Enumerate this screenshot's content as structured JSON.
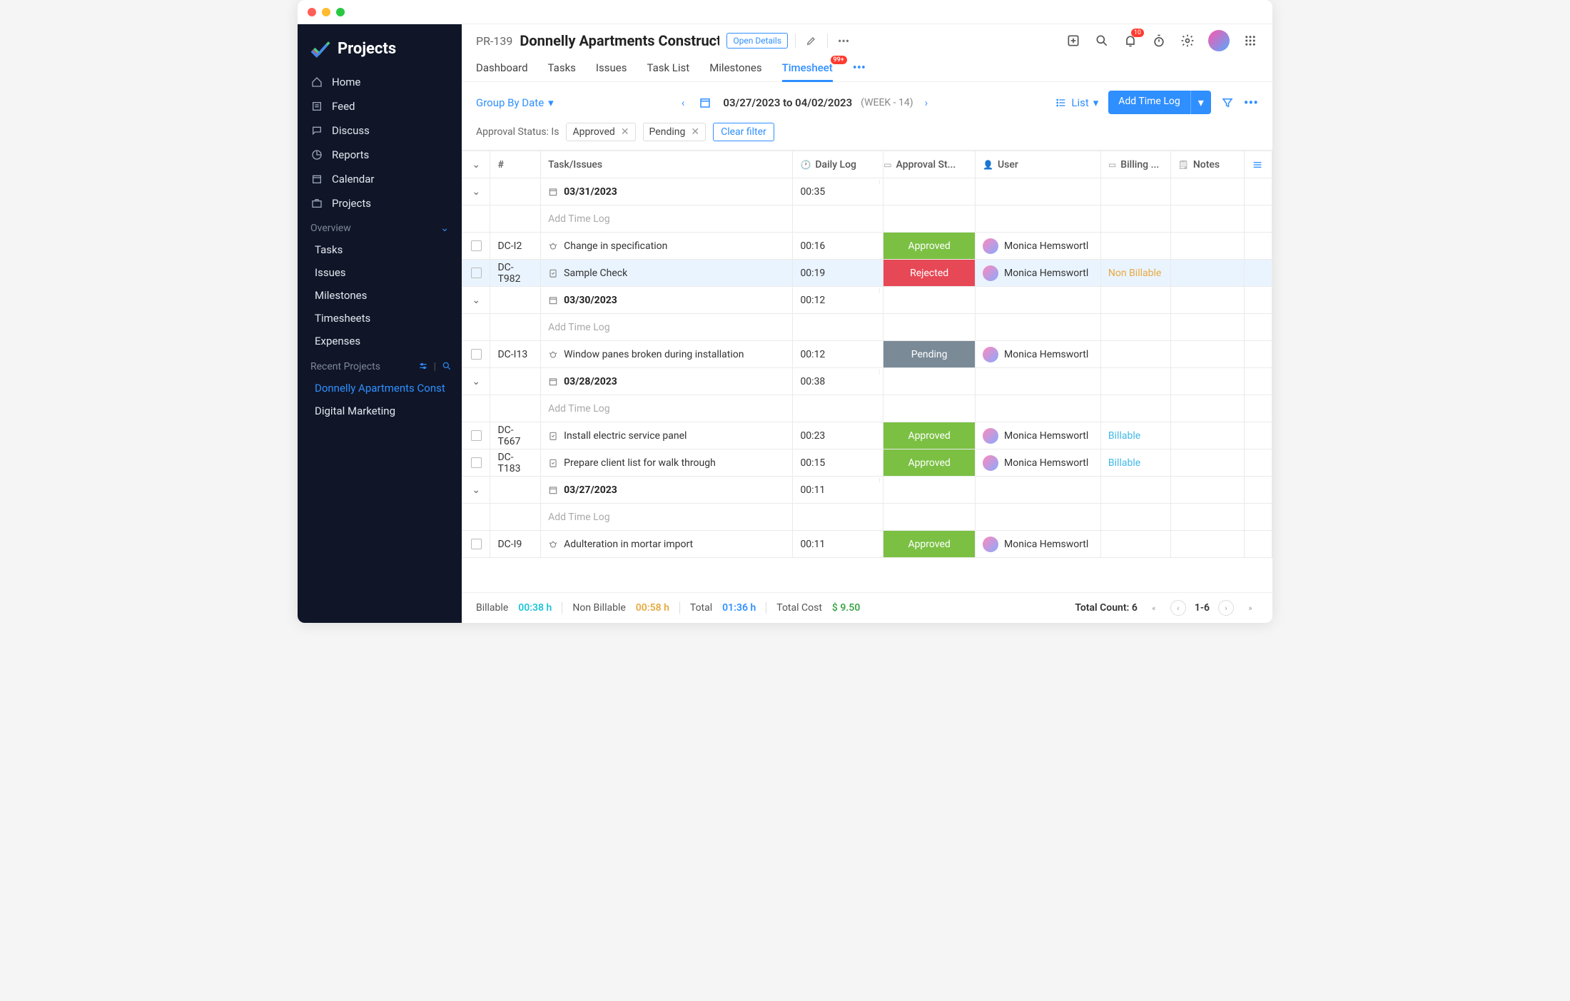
{
  "app": {
    "name": "Projects"
  },
  "sidebar": {
    "items": [
      {
        "label": "Home"
      },
      {
        "label": "Feed"
      },
      {
        "label": "Discuss"
      },
      {
        "label": "Reports"
      },
      {
        "label": "Calendar"
      },
      {
        "label": "Projects"
      }
    ],
    "overview_label": "Overview",
    "overview_items": [
      {
        "label": "Tasks"
      },
      {
        "label": "Issues"
      },
      {
        "label": "Milestones"
      },
      {
        "label": "Timesheets"
      },
      {
        "label": "Expenses"
      }
    ],
    "recent_label": "Recent Projects",
    "recent_items": [
      {
        "label": "Donnelly Apartments Const",
        "active": true
      },
      {
        "label": "Digital Marketing",
        "active": false
      }
    ]
  },
  "header": {
    "project_id": "PR-139",
    "project_title": "Donnelly Apartments Constructic",
    "open_details": "Open Details",
    "notification_count": "10"
  },
  "tabs": {
    "items": [
      "Dashboard",
      "Tasks",
      "Issues",
      "Task List",
      "Milestones",
      "Timesheet"
    ],
    "active_index": 5,
    "timesheet_badge": "99+"
  },
  "toolbar": {
    "group_by": "Group By Date",
    "date_range": "03/27/2023 to 04/02/2023",
    "week_label": "(WEEK - 14)",
    "view_label": "List",
    "add_label": "Add Time Log"
  },
  "filters": {
    "label": "Approval Status: Is",
    "chips": [
      "Approved",
      "Pending"
    ],
    "clear": "Clear filter"
  },
  "table": {
    "headers": {
      "num": "#",
      "task": "Task/Issues",
      "dailylog": "Daily Log",
      "approval": "Approval St...",
      "user": "User",
      "billing": "Billing ...",
      "notes": "Notes"
    },
    "add_time_log": "Add Time Log",
    "groups": [
      {
        "date": "03/31/2023",
        "total": "00:35",
        "rows": [
          {
            "id": "DC-I2",
            "type": "issue",
            "title": "Change in specification",
            "log": "00:16",
            "status": "Approved",
            "user": "Monica Hemswortl",
            "billing": ""
          },
          {
            "id": "DC-T982",
            "type": "task",
            "title": "Sample Check",
            "log": "00:19",
            "status": "Rejected",
            "user": "Monica Hemswortl",
            "billing": "Non Billable",
            "selected": true
          }
        ]
      },
      {
        "date": "03/30/2023",
        "total": "00:12",
        "rows": [
          {
            "id": "DC-I13",
            "type": "issue",
            "title": "Window panes broken during installation",
            "log": "00:12",
            "status": "Pending",
            "user": "Monica Hemswortl",
            "billing": ""
          }
        ]
      },
      {
        "date": "03/28/2023",
        "total": "00:38",
        "rows": [
          {
            "id": "DC-T667",
            "type": "task",
            "title": "Install electric service panel",
            "log": "00:23",
            "status": "Approved",
            "user": "Monica Hemswortl",
            "billing": "Billable"
          },
          {
            "id": "DC-T183",
            "type": "task",
            "title": "Prepare client list for walk through",
            "log": "00:15",
            "status": "Approved",
            "user": "Monica Hemswortl",
            "billing": "Billable"
          }
        ]
      },
      {
        "date": "03/27/2023",
        "total": "00:11",
        "rows": [
          {
            "id": "DC-I9",
            "type": "issue",
            "title": "Adulteration in mortar import",
            "log": "00:11",
            "status": "Approved",
            "user": "Monica Hemswortl",
            "billing": ""
          }
        ]
      }
    ]
  },
  "footer": {
    "billable_label": "Billable",
    "billable_value": "00:38 h",
    "nonbillable_label": "Non Billable",
    "nonbillable_value": "00:58 h",
    "total_label": "Total",
    "total_value": "01:36 h",
    "cost_label": "Total Cost",
    "cost_value": "$ 9.50",
    "count_label": "Total Count: 6",
    "page_range": "1-6"
  }
}
